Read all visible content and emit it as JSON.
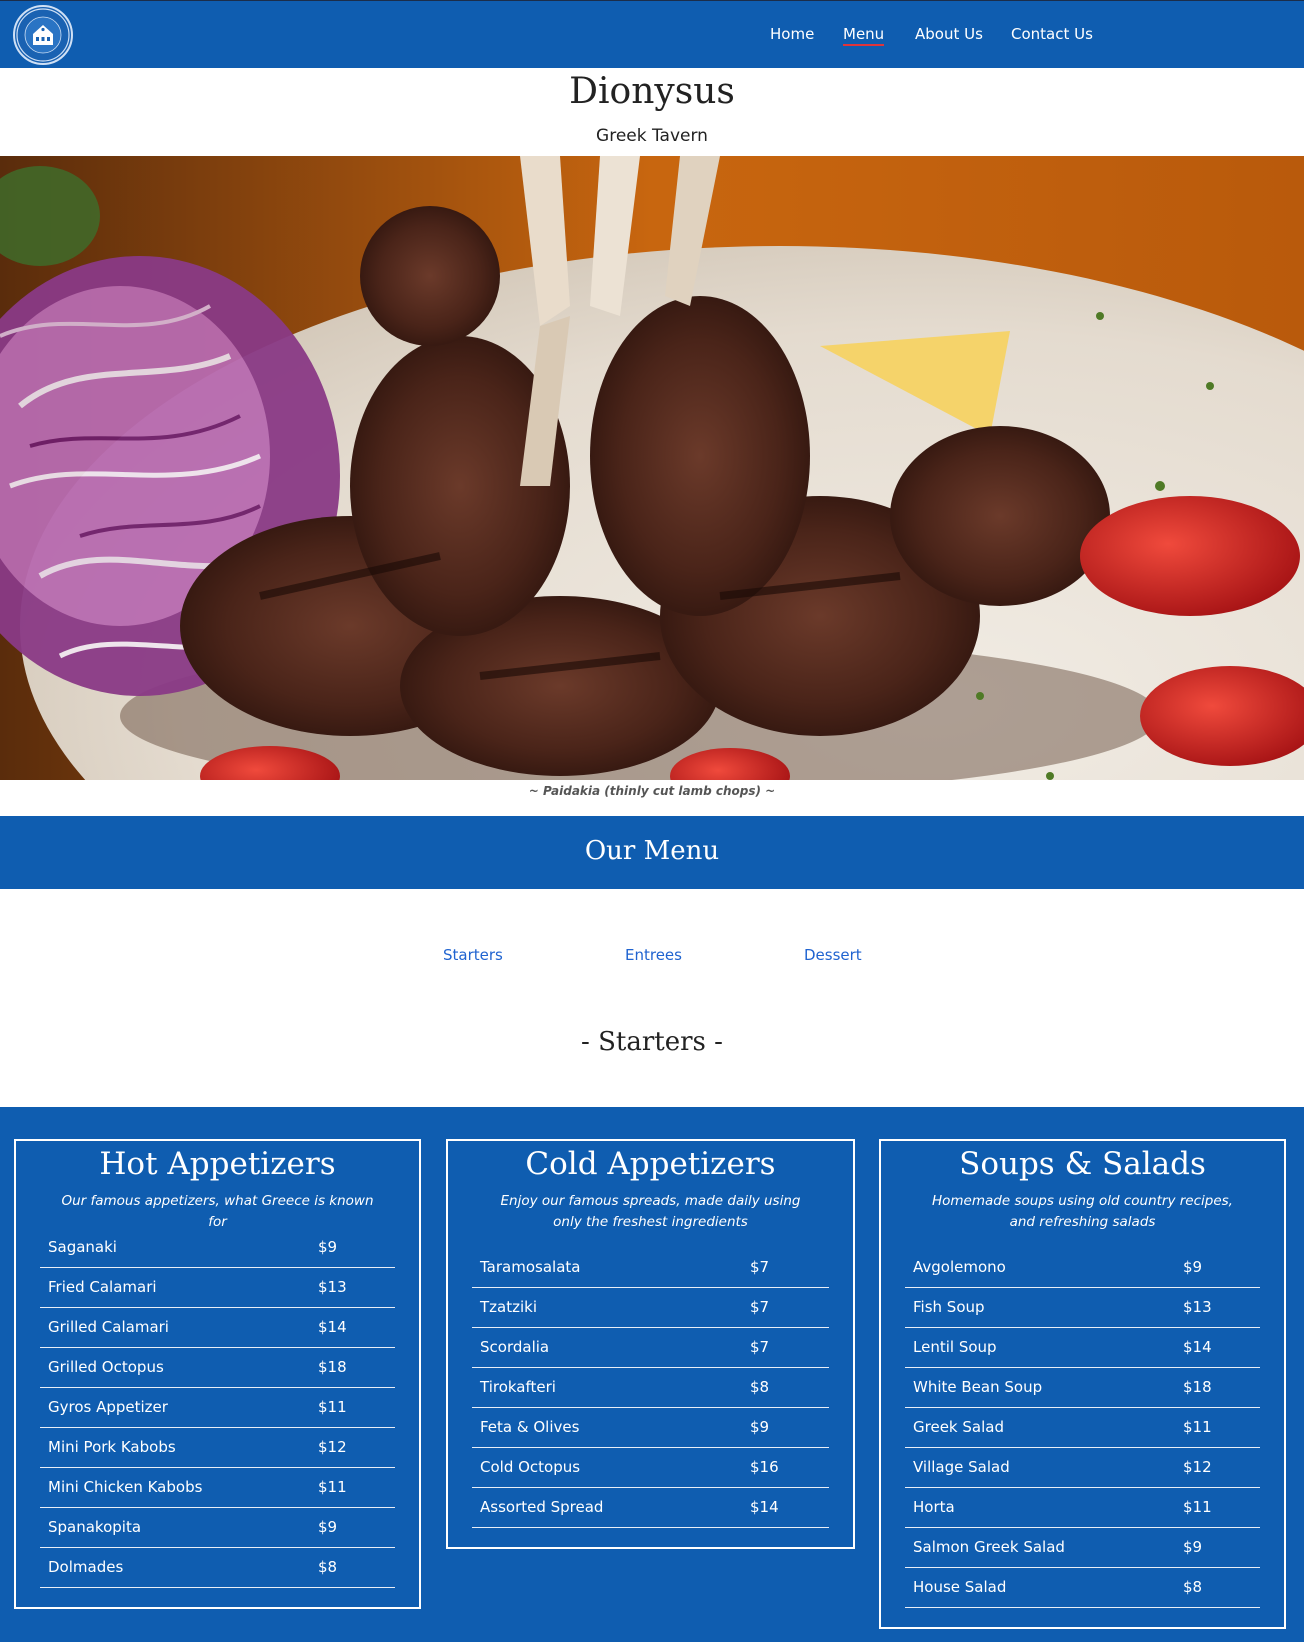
{
  "nav": {
    "logo_text": "DIONYSUS GREEK TAVERN",
    "links": [
      {
        "label": "Home"
      },
      {
        "label": "Menu"
      },
      {
        "label": "About Us"
      },
      {
        "label": "Contact Us"
      }
    ]
  },
  "header": {
    "title": "Dionysus",
    "subtitle": "Greek Tavern"
  },
  "hero": {
    "caption": "~ Paidakia (thinly cut lamb chops) ~"
  },
  "menu_band": {
    "title": "Our Menu"
  },
  "categories": [
    {
      "label": "Starters"
    },
    {
      "label": "Entrees"
    },
    {
      "label": "Dessert"
    }
  ],
  "section": {
    "title": "- Starters -"
  },
  "colors": {
    "brand_blue": "#0f5db0",
    "link_blue": "#1f63d0",
    "active_underline": "#e0343a"
  },
  "cards": [
    {
      "title": "Hot Appetizers",
      "description": "Our famous appetizers, what Greece is known for",
      "items": [
        {
          "name": "Saganaki",
          "price": "$9"
        },
        {
          "name": "Fried Calamari",
          "price": "$13"
        },
        {
          "name": "Grilled Calamari",
          "price": "$14"
        },
        {
          "name": "Grilled Octopus",
          "price": "$18"
        },
        {
          "name": "Gyros Appetizer",
          "price": "$11"
        },
        {
          "name": "Mini Pork Kabobs",
          "price": "$12"
        },
        {
          "name": "Mini Chicken Kabobs",
          "price": "$11"
        },
        {
          "name": "Spanakopita",
          "price": "$9"
        },
        {
          "name": "Dolmades",
          "price": "$8"
        }
      ]
    },
    {
      "title": "Cold Appetizers",
      "description": "Enjoy our famous spreads, made daily using only the freshest ingredients",
      "items": [
        {
          "name": "Taramosalata",
          "price": "$7"
        },
        {
          "name": "Tzatziki",
          "price": "$7"
        },
        {
          "name": "Scordalia",
          "price": "$7"
        },
        {
          "name": "Tirokafteri",
          "price": "$8"
        },
        {
          "name": "Feta & Olives",
          "price": "$9"
        },
        {
          "name": "Cold Octopus",
          "price": "$16"
        },
        {
          "name": "Assorted Spread",
          "price": "$14"
        }
      ]
    },
    {
      "title": "Soups & Salads",
      "description": "Homemade soups using old country recipes, and refreshing salads",
      "items": [
        {
          "name": "Avgolemono",
          "price": "$9"
        },
        {
          "name": "Fish Soup",
          "price": "$13"
        },
        {
          "name": "Lentil Soup",
          "price": "$14"
        },
        {
          "name": "White Bean Soup",
          "price": "$18"
        },
        {
          "name": "Greek Salad",
          "price": "$11"
        },
        {
          "name": "Village Salad",
          "price": "$12"
        },
        {
          "name": "Horta",
          "price": "$11"
        },
        {
          "name": "Salmon Greek Salad",
          "price": "$9"
        },
        {
          "name": "House Salad",
          "price": "$8"
        }
      ]
    }
  ]
}
